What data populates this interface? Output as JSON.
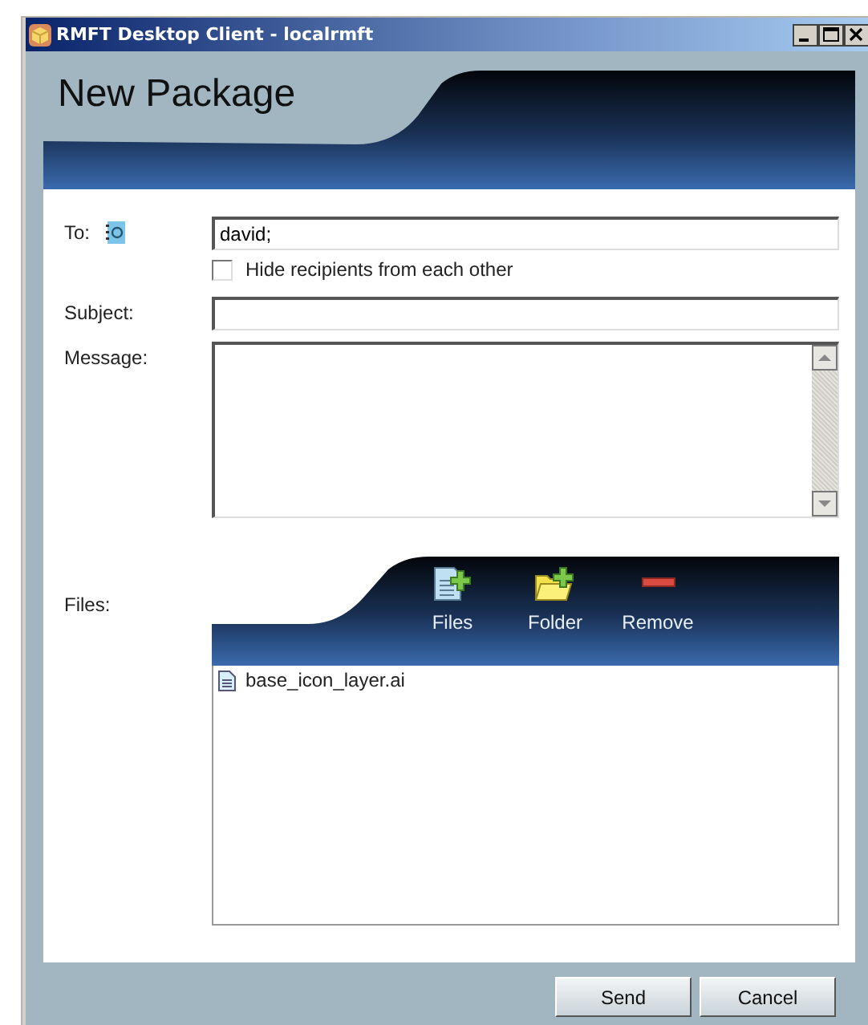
{
  "window": {
    "title": "RMFT Desktop Client - localrmft"
  },
  "header": {
    "title": "New Package"
  },
  "to": {
    "label": "To:",
    "value": "david;"
  },
  "hide_recipients": {
    "label": "Hide recipients from each other",
    "checked": false
  },
  "subject": {
    "label": "Subject:"
  },
  "message": {
    "label": "Message:"
  },
  "files": {
    "label": "Files:",
    "toolbar": [
      {
        "kind": "files",
        "label": "Files"
      },
      {
        "kind": "folder",
        "label": "Folder"
      },
      {
        "kind": "remove",
        "label": "Remove"
      }
    ],
    "items": [
      "base_icon_layer.ai"
    ]
  },
  "buttons": [
    "Send",
    "Cancel"
  ]
}
